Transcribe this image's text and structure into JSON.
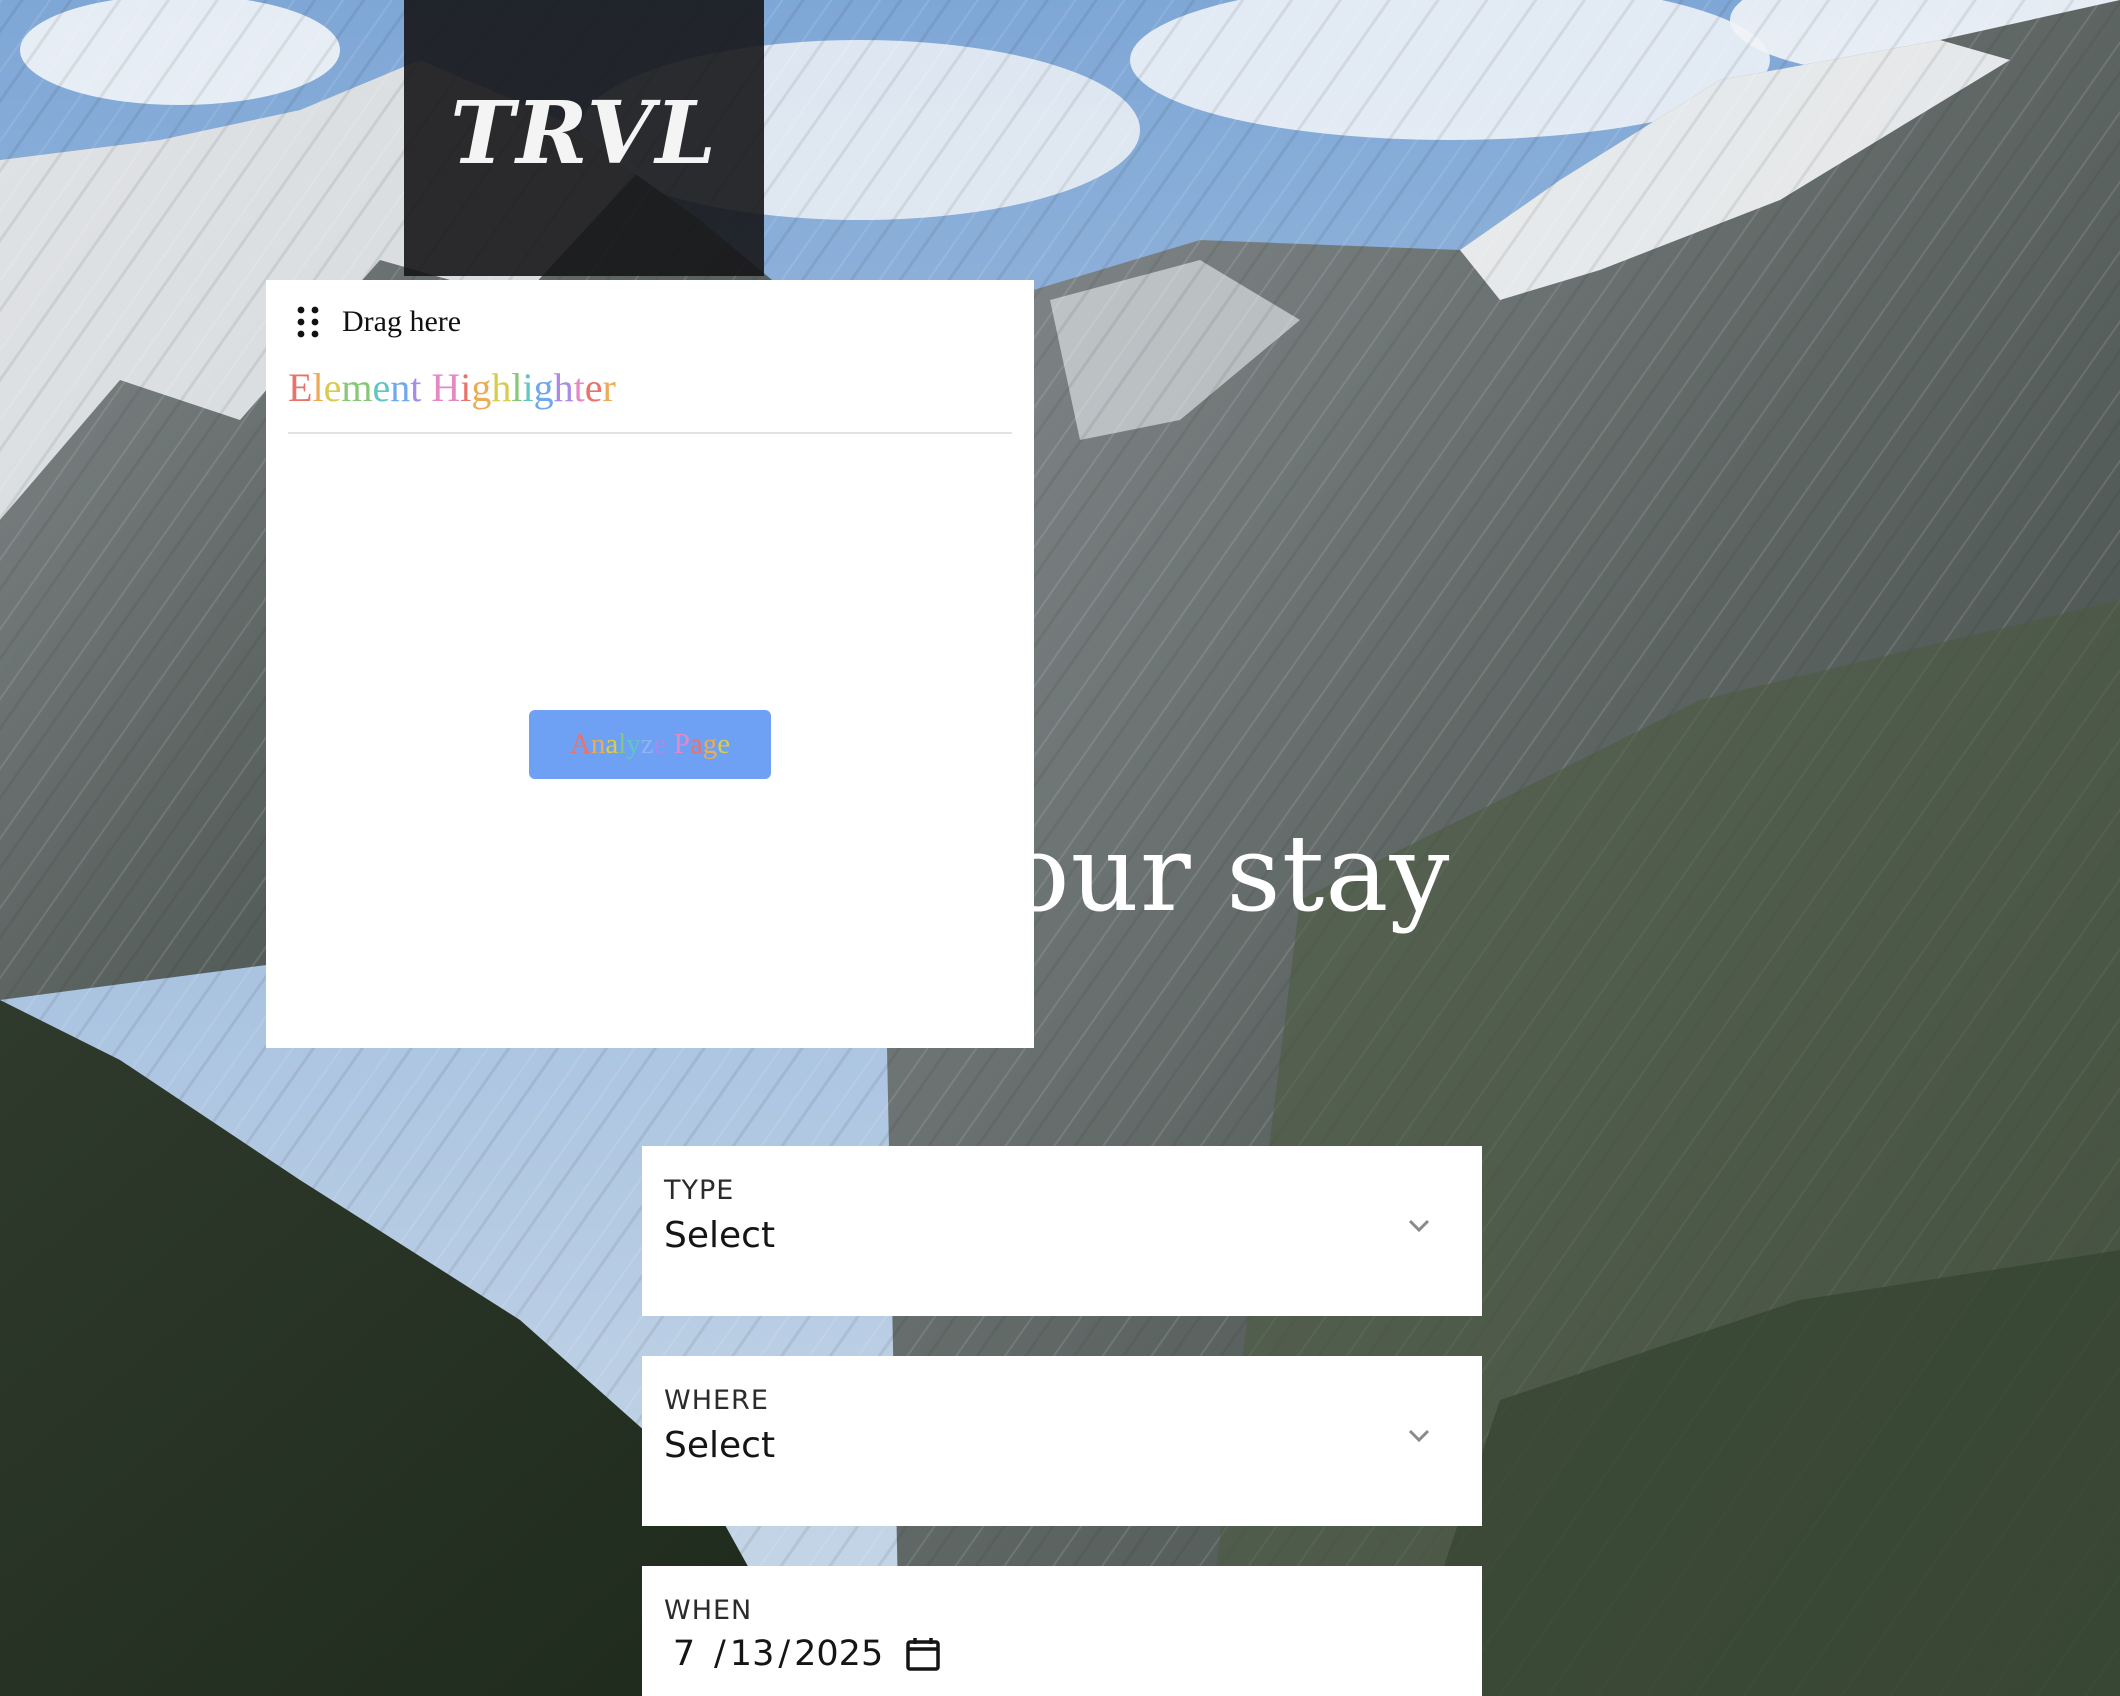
{
  "brand": {
    "logo": "TRVL"
  },
  "hero": {
    "title": "Plan your stay"
  },
  "form": {
    "type": {
      "label": "TYPE",
      "value": "Select"
    },
    "where": {
      "label": "WHERE",
      "value": "Select"
    },
    "when": {
      "label": "WHEN",
      "month": "7",
      "day": "13",
      "year": "2025",
      "sep": "/"
    }
  },
  "highlighter": {
    "drag_label": "Drag here",
    "title": "Element Highlighter",
    "title_colors": [
      "#e8736b",
      "#ecab55",
      "#d7cc4f",
      "#86c876",
      "#5fc6c1",
      "#6fa8ec",
      "#a88be8",
      "#e489c6"
    ],
    "button_label": "Analyze Page",
    "button_colors": [
      "#e8736b",
      "#ecab55",
      "#d7cc4f",
      "#86c876",
      "#5fc6c1",
      "#8fb3f5",
      "#a88be8",
      "#e489c6"
    ]
  }
}
